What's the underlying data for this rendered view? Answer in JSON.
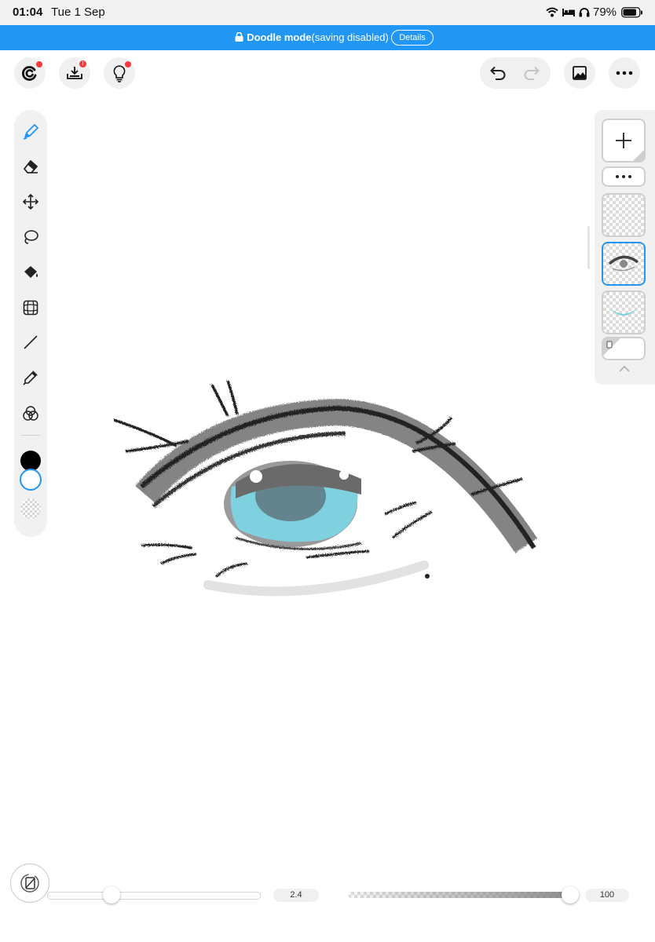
{
  "status_bar": {
    "time": "01:04",
    "date": "Tue 1 Sep",
    "battery": "79%"
  },
  "banner": {
    "title": "Doodle mode",
    "subtitle": "(saving disabled)",
    "details_label": "Details"
  },
  "toolbar": {
    "badge": "!"
  },
  "bottom": {
    "brush_size": 2.4,
    "brush_size_label": "2.4",
    "opacity": 100,
    "opacity_label": "100"
  },
  "colors": {
    "accent": "#2196f3",
    "banner": "#2196f3",
    "badge": "#f03c3c",
    "main_color": "#000000",
    "iris": "#7fd1df"
  },
  "tools": [
    "pen-icon",
    "eraser-icon",
    "move-icon",
    "lasso-icon",
    "fill-icon",
    "transform-icon",
    "line-icon",
    "eyedropper-icon",
    "color-mix-icon"
  ]
}
